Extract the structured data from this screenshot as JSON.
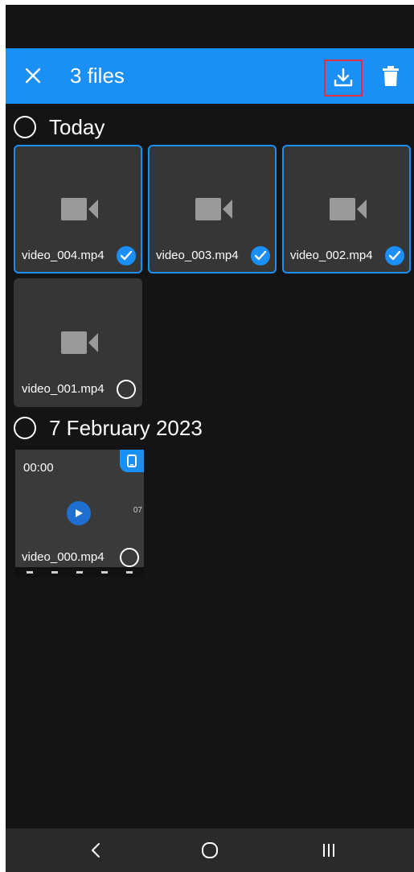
{
  "app_bar": {
    "title": "3 files",
    "color": "#1a8ff5"
  },
  "icons": {
    "close": "close-icon",
    "download": "download-icon",
    "delete": "trash-icon",
    "camera": "video-camera-icon",
    "check": "checkmark-icon",
    "play": "play-icon",
    "device": "phone-icon",
    "back": "back-chevron-icon",
    "home": "home-circle-icon",
    "recents": "recent-apps-icon"
  },
  "sections": [
    {
      "title": "Today",
      "files": [
        {
          "name": "video_004.mp4",
          "selected": true
        },
        {
          "name": "video_003.mp4",
          "selected": true
        },
        {
          "name": "video_002.mp4",
          "selected": true
        },
        {
          "name": "video_001.mp4",
          "selected": false
        }
      ]
    },
    {
      "title": "7 February 2023",
      "files": [
        {
          "name": "video_000.mp4",
          "selected": false,
          "thumb_time": "00:00",
          "thumb_side_text": "07"
        }
      ]
    }
  ]
}
